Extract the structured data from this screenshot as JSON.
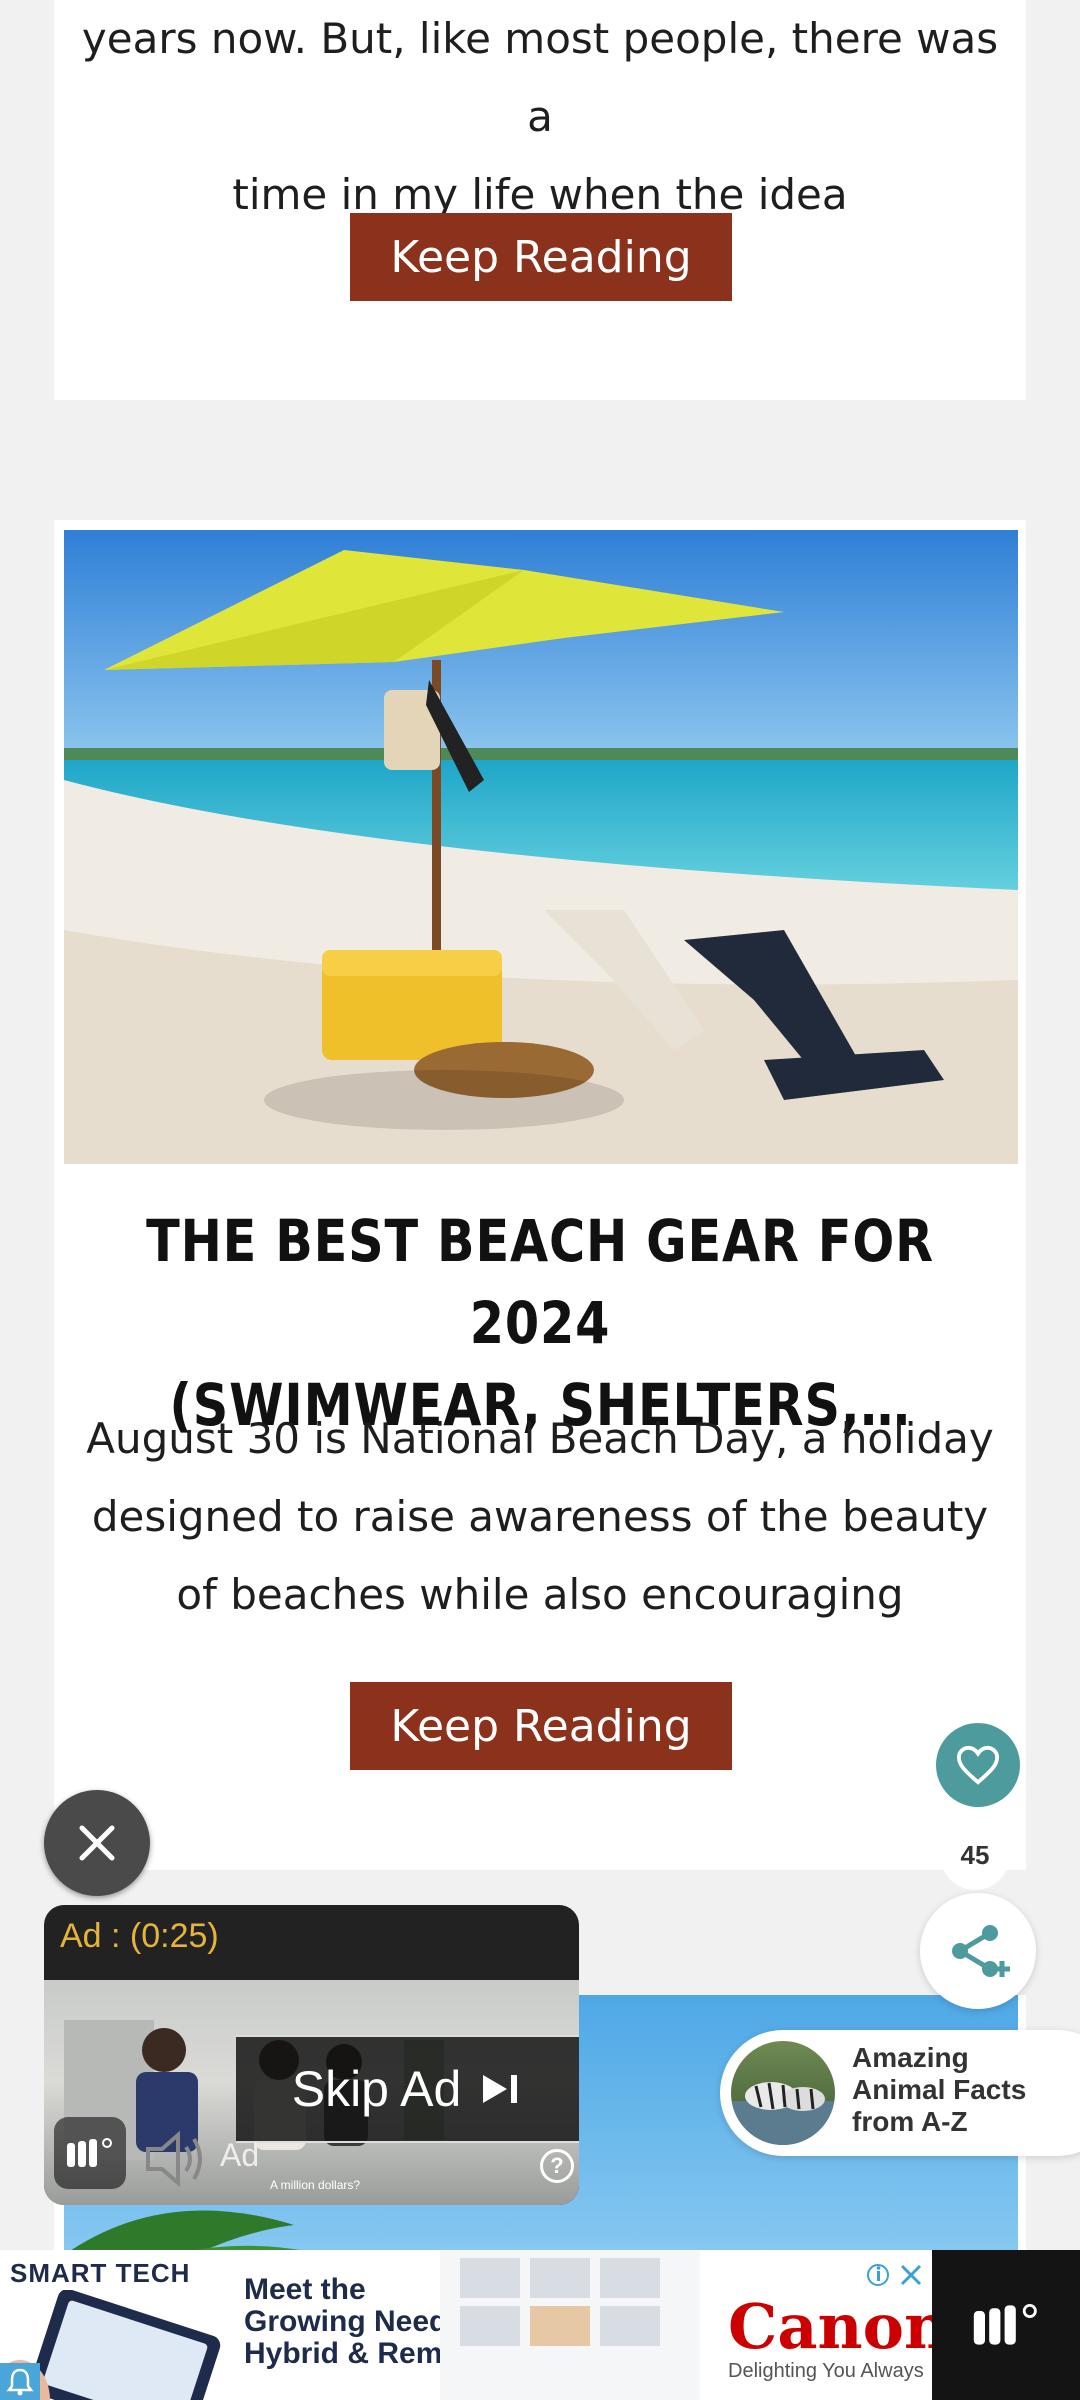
{
  "card1": {
    "text_line1": "years now. But, like most people, there was a",
    "text_line2": "time in my life when the idea",
    "button": "Keep Reading"
  },
  "card2": {
    "title_line1": "THE BEST BEACH GEAR FOR 2024",
    "title_line2": "(SWIMWEAR, SHELTERS,…",
    "desc_line1": "August 30 is National Beach Day, a holiday",
    "desc_line2": "designed to raise awareness of the beauty",
    "desc_line3": "of  beaches while also encouraging",
    "button": "Keep Reading"
  },
  "social": {
    "like_count": "45"
  },
  "video_ad": {
    "timer": "Ad : (0:25)",
    "skip_label": "Skip Ad",
    "ad_label": "Ad",
    "caption": "A million dollars?",
    "help": "?"
  },
  "recommendation": {
    "line1": "Amazing",
    "line2": "Animal Facts",
    "line3": "from A-Z"
  },
  "banner_ad": {
    "brand": "SMART TECH",
    "headline_line1": "Meet the",
    "headline_line2": "Growing Needs of",
    "headline_line3": "Hybrid & Remote Learning",
    "advertiser": "Canon",
    "tagline": "Delighting You Always"
  },
  "colors": {
    "button_bg": "#8c311b",
    "like_bg": "#4e9b9e",
    "ad_timer": "#e5b43a",
    "canon_red": "#cc0000"
  }
}
